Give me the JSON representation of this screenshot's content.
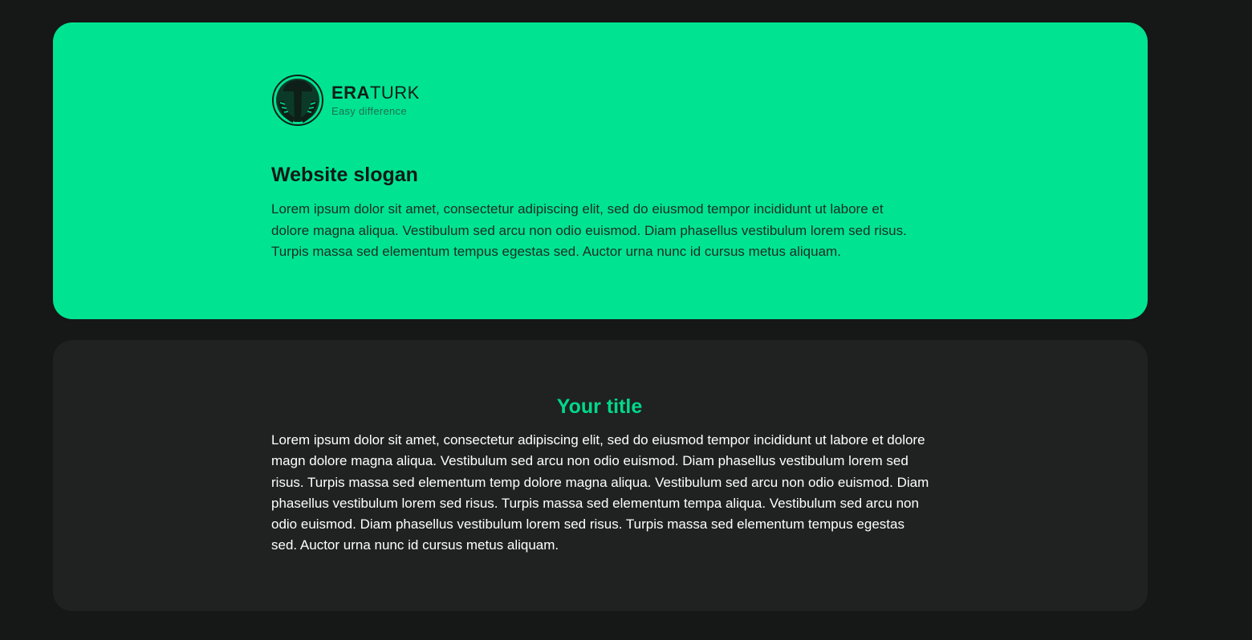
{
  "colors": {
    "page_background": "#161717",
    "accent": "#00e492",
    "card_dark": "#202121",
    "title_accent": "#00d98a"
  },
  "hero": {
    "logo": {
      "icon": "eraturk-logo-icon",
      "name_bold": "ERA",
      "name_light": "TURK",
      "tagline": "Easy difference"
    },
    "title": "Website slogan",
    "body": "Lorem ipsum dolor sit amet, consectetur adipiscing elit, sed do eiusmod tempor incididunt ut labore et dolore magna aliqua. Vestibulum sed arcu non odio euismod. Diam phasellus vestibulum lorem sed risus. Turpis massa sed elementum tempus egestas sed. Auctor urna nunc id cursus metus aliquam."
  },
  "content": {
    "title": "Your title",
    "body": "Lorem ipsum dolor sit amet, consectetur adipiscing elit, sed do eiusmod tempor incididunt ut labore et dolore magn dolore magna aliqua. Vestibulum sed arcu non odio euismod. Diam phasellus vestibulum lorem sed risus. Turpis massa sed elementum temp dolore magna aliqua. Vestibulum sed arcu non odio euismod. Diam phasellus vestibulum lorem sed risus. Turpis massa sed elementum tempa aliqua. Vestibulum sed arcu non odio euismod. Diam phasellus vestibulum lorem sed risus. Turpis massa sed elementum tempus egestas sed. Auctor urna nunc id cursus metus aliquam."
  }
}
